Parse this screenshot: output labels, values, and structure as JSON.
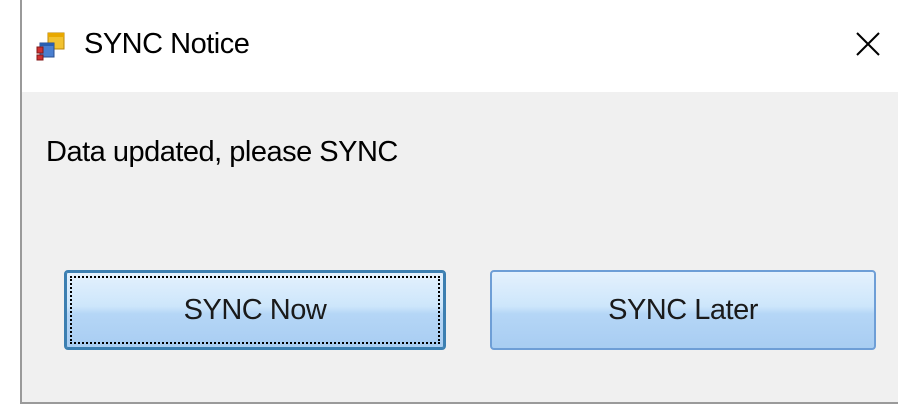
{
  "window": {
    "title": "SYNC Notice",
    "app_icon": "windows-form-icon",
    "close_icon": "close-icon"
  },
  "dialog": {
    "message": "Data updated, please SYNC"
  },
  "buttons": {
    "sync_now_label": "SYNC Now",
    "sync_later_label": "SYNC Later",
    "focused": "sync_now"
  },
  "colors": {
    "titlebar_bg": "#ffffff",
    "client_bg": "#f0f0f0",
    "button_border": "#6e9ed6",
    "button_gradient_top": "#e4f1fd",
    "button_gradient_bottom": "#a8cdf2"
  }
}
